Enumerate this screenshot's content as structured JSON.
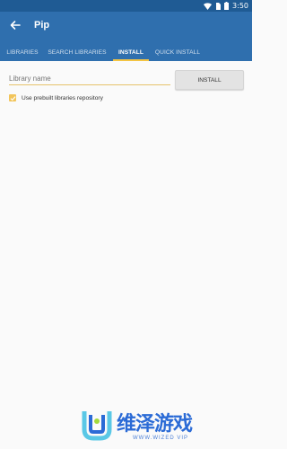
{
  "status_bar": {
    "time": "3:50"
  },
  "app_bar": {
    "title": "Pip"
  },
  "tabs": [
    {
      "label": "LIBRARIES"
    },
    {
      "label": "SEARCH LIBRARIES"
    },
    {
      "label": "INSTALL"
    },
    {
      "label": "QUICK INSTALL"
    }
  ],
  "install": {
    "placeholder": "Library name",
    "button_label": "INSTALL",
    "checkbox_label": "Use prebuilt libraries repository",
    "checkbox_checked": true
  },
  "watermark": {
    "title": "维泽游戏",
    "subtitle": "WWW.WIZED VIP"
  },
  "colors": {
    "appbar": "#2f6fae",
    "statusbar": "#1f5b94",
    "accent": "#f3c443"
  }
}
